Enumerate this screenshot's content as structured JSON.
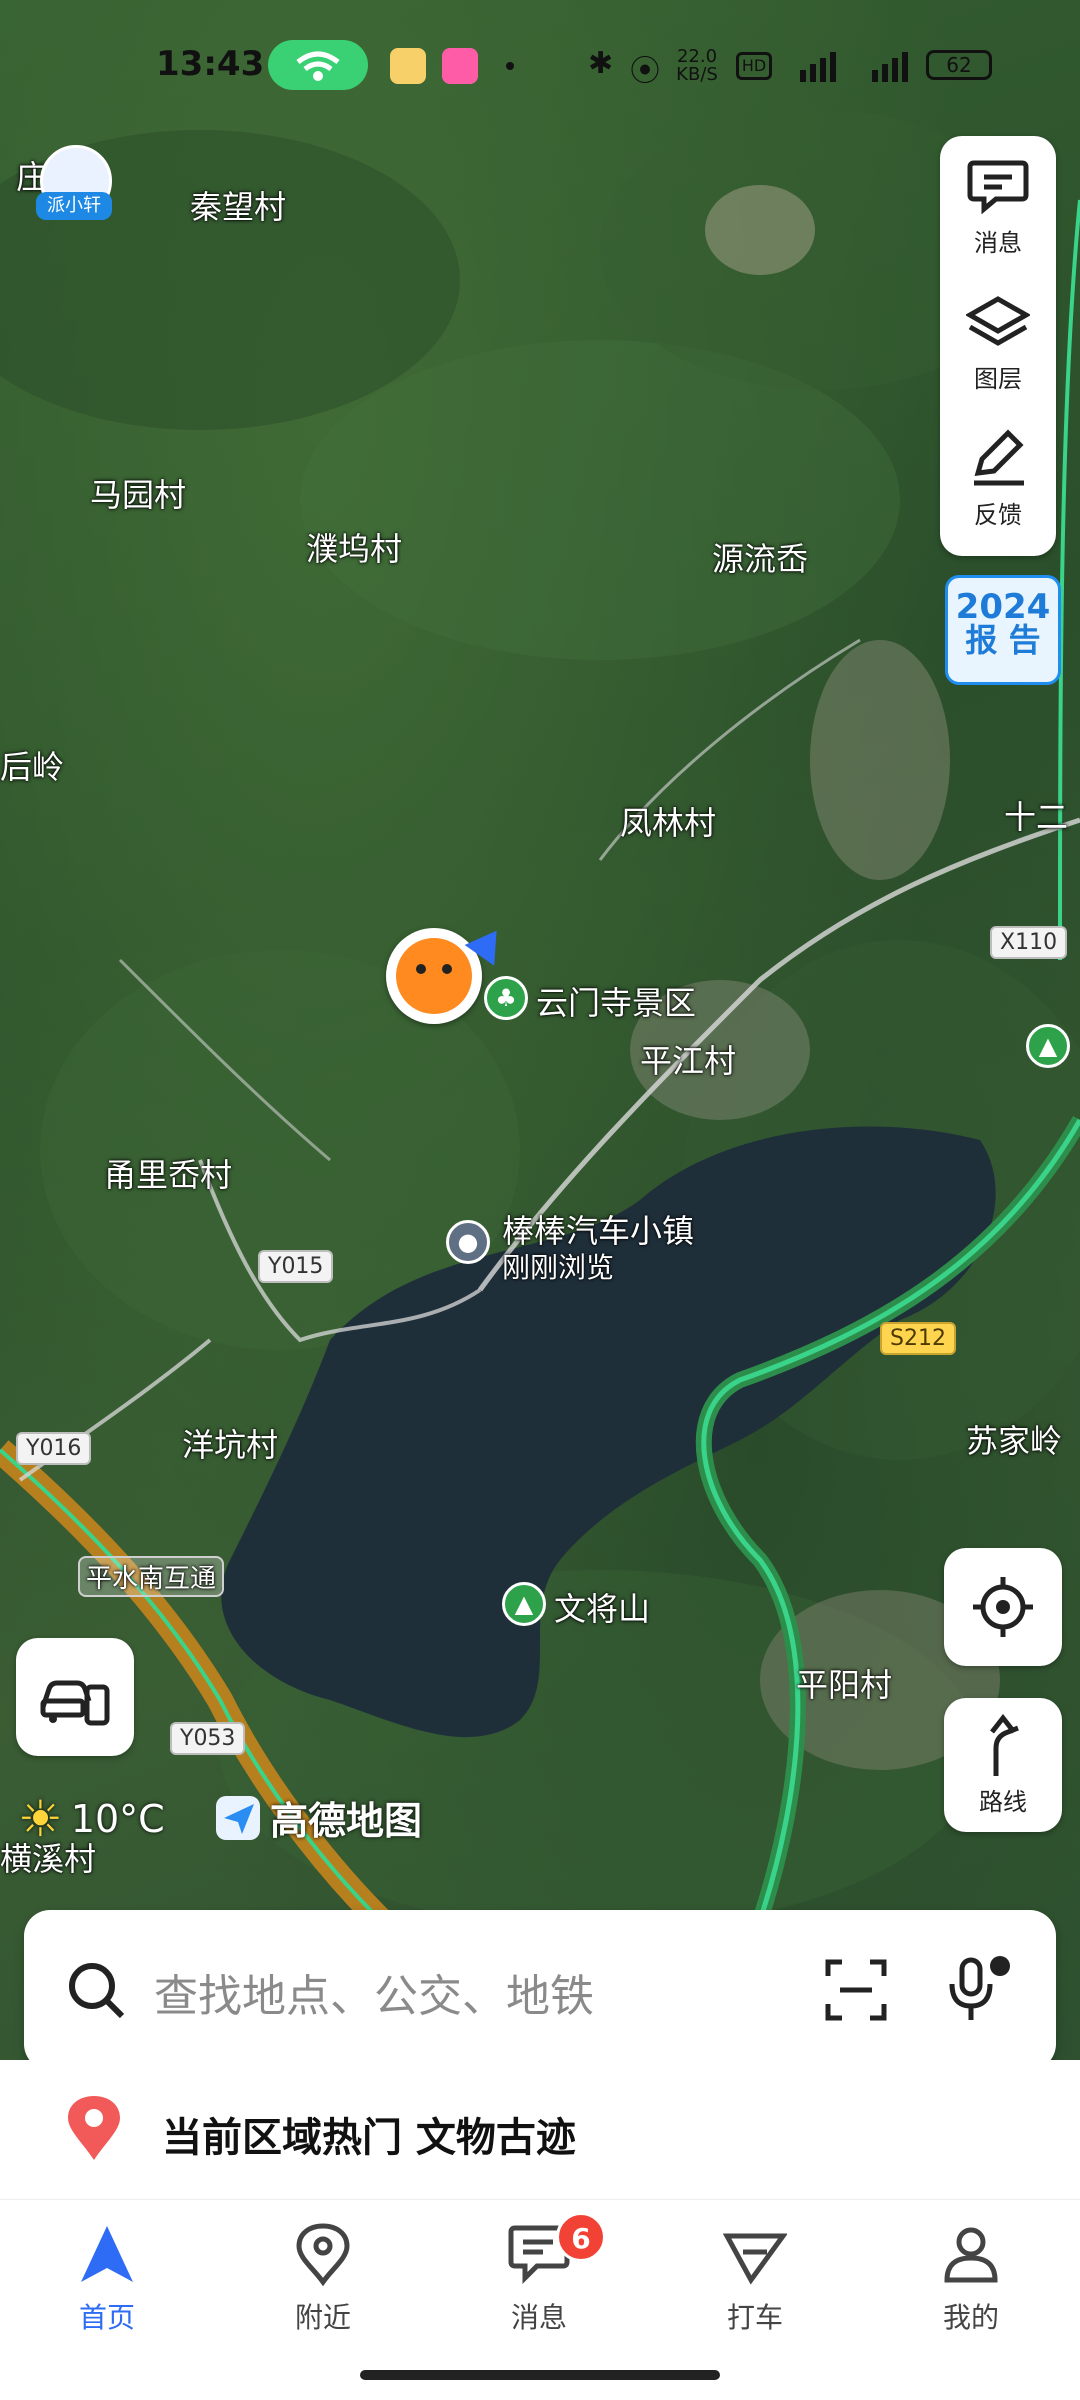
{
  "status_bar": {
    "time": "13:43",
    "speed": "22.0 KB/S",
    "battery": "62",
    "icons": [
      "wifi-icon",
      "bluetooth-icon",
      "location-icon",
      "hd-icon",
      "signal-icon"
    ]
  },
  "assistant": {
    "label": "派小轩"
  },
  "map": {
    "labels": [
      "庄",
      "秦望村",
      "马园村",
      "濮坞村",
      "源流岙",
      "后岭",
      "凤林村",
      "十二",
      "云门寺景区",
      "平江村",
      "甬里岙村",
      "棒棒汽车小镇",
      "刚刚浏览",
      "洋坑村",
      "苏家岭",
      "平水南互通",
      "文将山",
      "平阳村",
      "横溪村"
    ],
    "roads": [
      "X110",
      "Y015",
      "S212",
      "Y016",
      "Y053"
    ],
    "colors": {
      "highway": "#3ad38a",
      "water": "#1f2f3a"
    }
  },
  "tools": {
    "messages": "消息",
    "layers": "图层",
    "feedback": "反馈"
  },
  "report_badge": {
    "year": "2024",
    "text": "报 告"
  },
  "weather": {
    "temp": "10°C",
    "icon": "sun-icon"
  },
  "brand": {
    "name": "高德地图"
  },
  "route_button": {
    "label": "路线"
  },
  "search": {
    "placeholder": "查找地点、公交、地铁"
  },
  "hot": {
    "text": "当前区域热门 文物古迹"
  },
  "tabs": [
    {
      "label": "首页",
      "icon": "navigation-arrow-icon"
    },
    {
      "label": "附近",
      "icon": "map-pin-icon"
    },
    {
      "label": "消息",
      "icon": "chat-icon",
      "badge": "6"
    },
    {
      "label": "打车",
      "icon": "taxi-icon"
    },
    {
      "label": "我的",
      "icon": "user-icon"
    }
  ]
}
